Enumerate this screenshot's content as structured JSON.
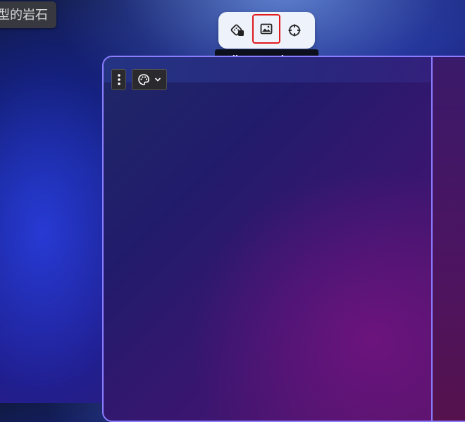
{
  "window": {
    "title_chip": "型的岩石"
  },
  "toolbar": {
    "buttons": [
      {
        "icon": "dice-icon"
      },
      {
        "icon": "image-icon"
      },
      {
        "icon": "crosshair-icon"
      }
    ]
  },
  "tooltip": {
    "text": "Edit accent image"
  },
  "card": {
    "menu_icon": "more-vertical-icon",
    "palette_icon": "palette-icon",
    "chevron_icon": "chevron-down-icon"
  },
  "colors": {
    "card_border": "#8a7dff",
    "highlight_border": "#e01b1b",
    "toolbar_bg": "#eef2fa",
    "tooltip_bg": "#0c0f1c"
  }
}
